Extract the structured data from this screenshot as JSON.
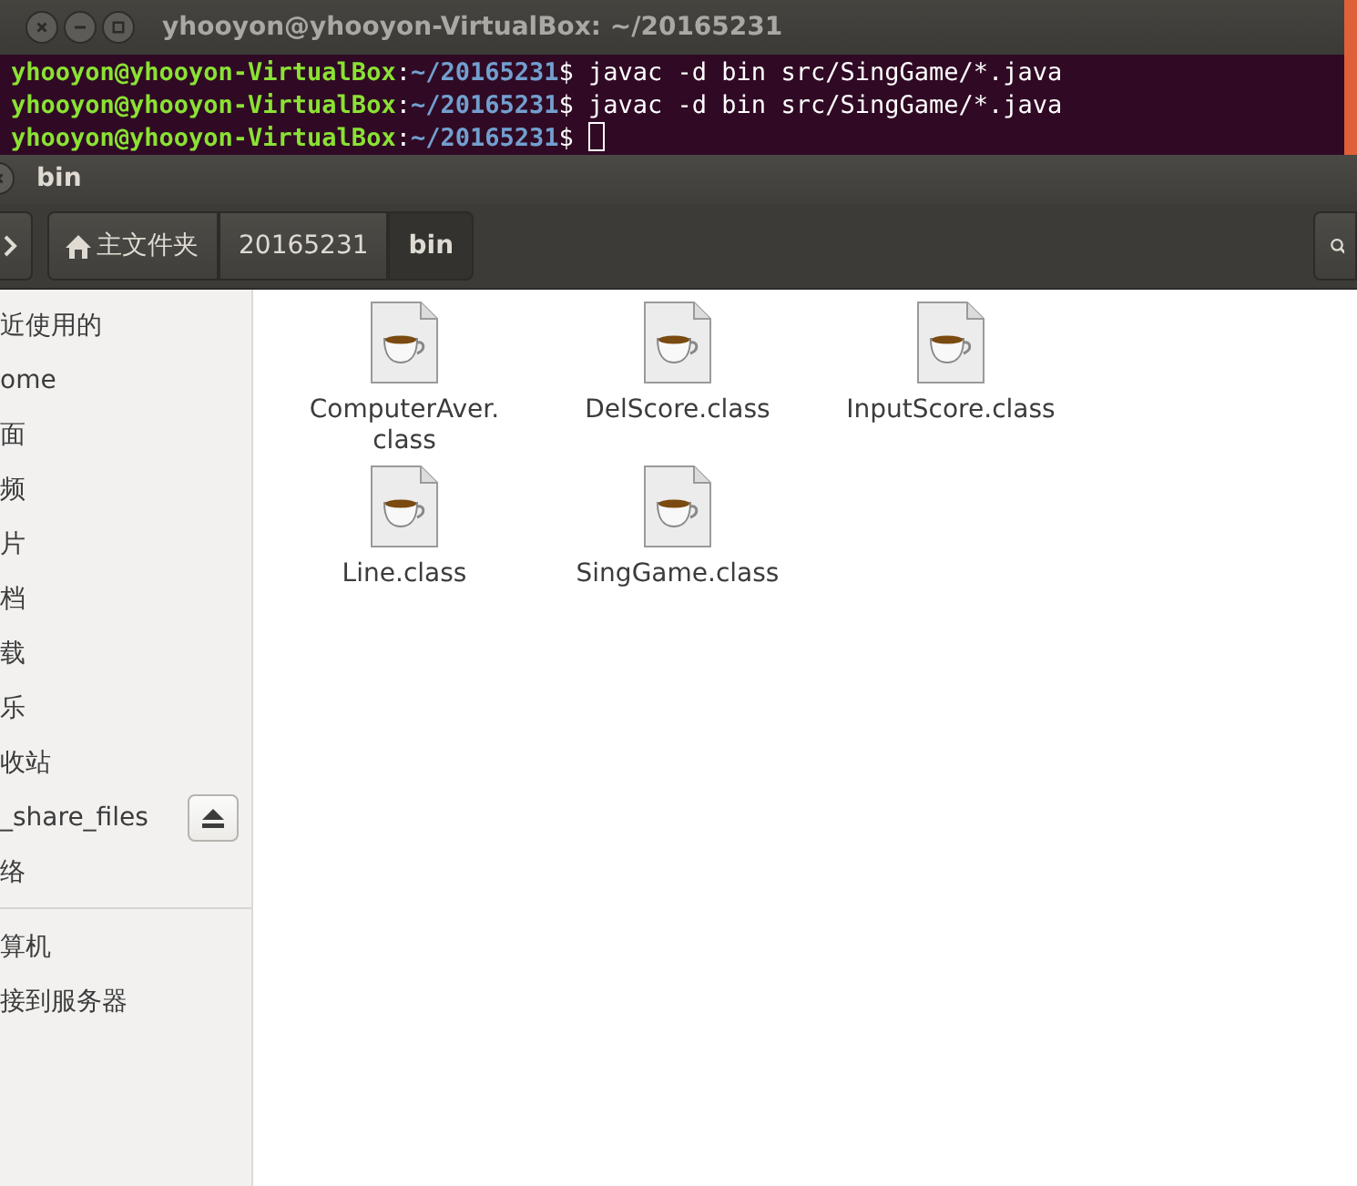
{
  "terminal": {
    "title": "yhooyon@yhooyon-VirtualBox: ~/20165231",
    "lines": [
      {
        "user_host": "yhooyon@yhooyon-VirtualBox",
        "separator": ":",
        "path": "~/20165231",
        "symbol": "$",
        "command": "javac -d bin src/SingGame/*.java",
        "cursor": false
      },
      {
        "user_host": "yhooyon@yhooyon-VirtualBox",
        "separator": ":",
        "path": "~/20165231",
        "symbol": "$",
        "command": "javac -d bin src/SingGame/*.java",
        "cursor": false
      },
      {
        "user_host": "yhooyon@yhooyon-VirtualBox",
        "separator": ":",
        "path": "~/20165231",
        "symbol": "$",
        "cursor": true
      }
    ]
  },
  "file_manager": {
    "title": "bin",
    "breadcrumbs": [
      {
        "label": "主文件夹",
        "home": true,
        "selected": false
      },
      {
        "label": "20165231",
        "home": false,
        "selected": false
      },
      {
        "label": "bin",
        "home": false,
        "selected": true
      }
    ],
    "sidebar": {
      "sections": [
        [
          {
            "label": "近使用的",
            "eject": false
          },
          {
            "label": "ome",
            "eject": false
          },
          {
            "label": "面",
            "eject": false
          },
          {
            "label": "频",
            "eject": false
          },
          {
            "label": "片",
            "eject": false
          },
          {
            "label": "档",
            "eject": false
          },
          {
            "label": "载",
            "eject": false
          },
          {
            "label": "乐",
            "eject": false
          },
          {
            "label": "收站",
            "eject": false
          },
          {
            "label": "_share_files",
            "eject": true
          },
          {
            "label": "络",
            "eject": false
          }
        ],
        [
          {
            "label": "算机",
            "eject": false
          },
          {
            "label": "接到服务器",
            "eject": false
          }
        ]
      ]
    },
    "files": [
      {
        "name": "ComputerAver.class"
      },
      {
        "name": "DelScore.class"
      },
      {
        "name": "InputScore.class"
      },
      {
        "name": "Line.class"
      },
      {
        "name": "SingGame.class"
      }
    ]
  }
}
